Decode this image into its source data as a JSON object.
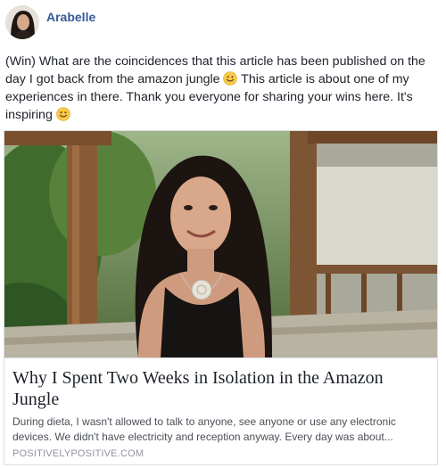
{
  "post": {
    "author": "Arabelle",
    "text_segments": [
      "(Win) What are the coincidences that this article has been published on the day I got back from the amazon jungle ",
      " This article is about one of my experiences in there. Thank you everyone for sharing your wins here. It's inspiring "
    ],
    "emoji_icon": "smiley-face-icon"
  },
  "link_card": {
    "title": "Why I Spent Two Weeks in Isolation in the Amazon Jungle",
    "description": "During dieta, I wasn't allowed to talk to anyone, see anyone or use any electronic devices. We didn't have electricity and reception anyway. Every day was about...",
    "domain": "POSITIVELYPOSITIVE.COM"
  },
  "colors": {
    "author_link": "#365899",
    "body_text": "#1d2129",
    "muted_text": "#90949c",
    "emoji_yellow": "#f7c948"
  }
}
